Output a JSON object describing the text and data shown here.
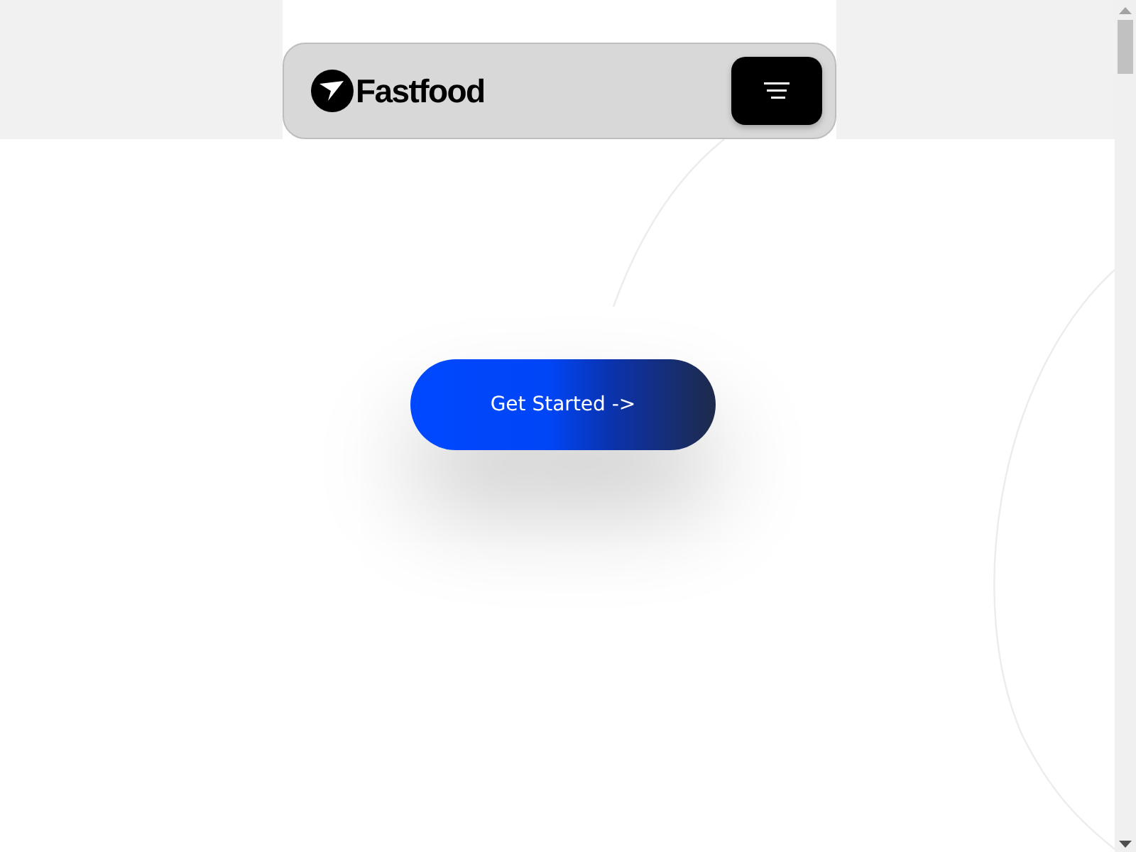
{
  "header": {
    "brand": "Fastfood"
  },
  "hero": {
    "button": "Get Started ->"
  }
}
